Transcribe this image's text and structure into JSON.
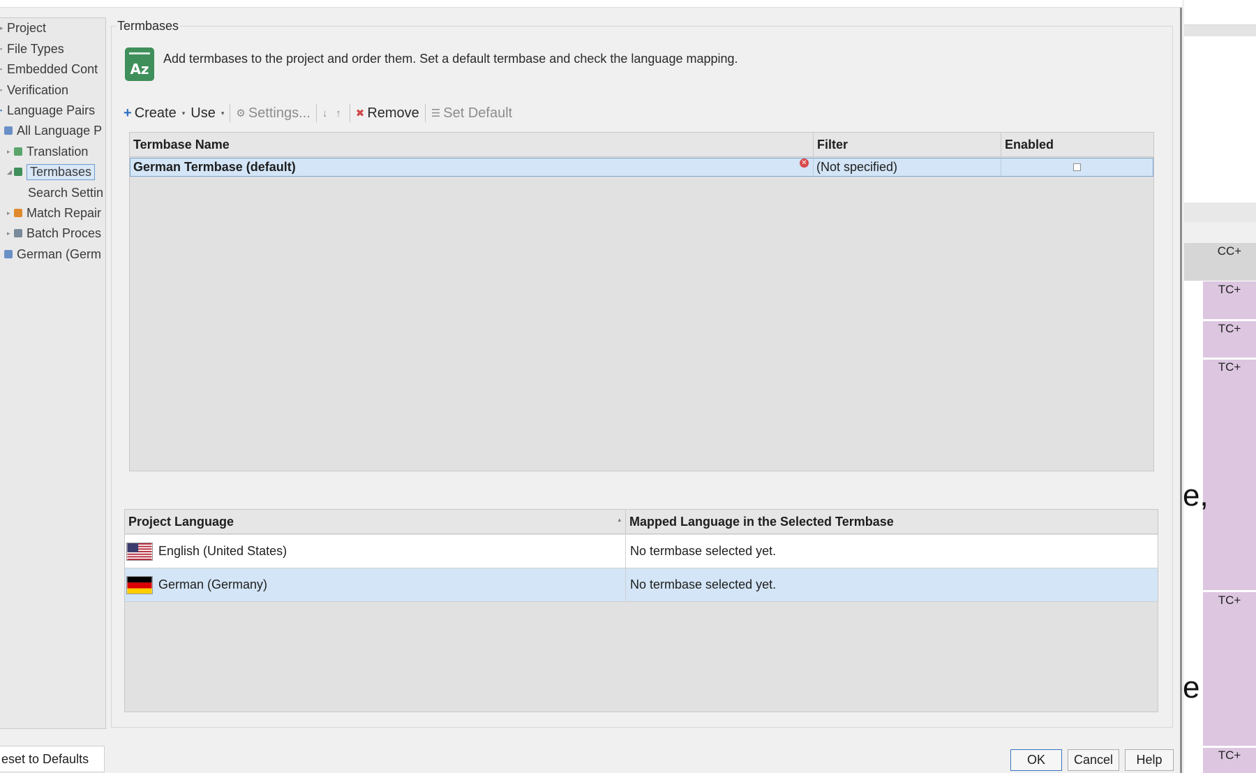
{
  "sidebar": {
    "items": [
      {
        "label": "Project"
      },
      {
        "label": "File Types"
      },
      {
        "label": "Embedded Cont"
      },
      {
        "label": "Verification"
      },
      {
        "label": "Language Pairs"
      },
      {
        "label": "All Language P"
      },
      {
        "label": "Translation"
      },
      {
        "label": "Termbases"
      },
      {
        "label": "Search Settin"
      },
      {
        "label": "Match Repair"
      },
      {
        "label": "Batch Proces"
      },
      {
        "label": "German (Germ"
      }
    ],
    "reset_label": "eset to Defaults"
  },
  "group": {
    "title": "Termbases",
    "description": "Add termbases to the project and order them. Set a default termbase and check the language mapping.",
    "icon_text": "Az"
  },
  "toolbar": {
    "create": "Create",
    "use": "Use",
    "settings": "Settings...",
    "remove": "Remove",
    "set_default": "Set Default"
  },
  "termbases": {
    "columns": [
      "Termbase Name",
      "Filter",
      "Enabled"
    ],
    "rows": [
      {
        "name": "German Termbase (default)",
        "filter": "(Not specified)",
        "enabled": false
      }
    ]
  },
  "languages": {
    "columns": [
      "Project Language",
      "Mapped Language in the Selected Termbase"
    ],
    "rows": [
      {
        "language": "English (United States)",
        "mapped": "No termbase selected yet.",
        "flag": "us-flag-icon"
      },
      {
        "language": "German (Germany)",
        "mapped": "No termbase selected yet.",
        "flag": "de-flag-icon"
      }
    ]
  },
  "buttons": {
    "ok": "OK",
    "cancel": "Cancel",
    "help": "Help"
  },
  "background_window": {
    "labels": [
      "CC+",
      "TC+",
      "TC+",
      "TC+",
      "TC+",
      "TC+"
    ],
    "fragment_1": "e,",
    "fragment_2": "e"
  },
  "colors": {
    "selection": "#d3e5f6",
    "termbase_icon": "#3f8f5a",
    "segment_purple": "#dcc6e0"
  }
}
